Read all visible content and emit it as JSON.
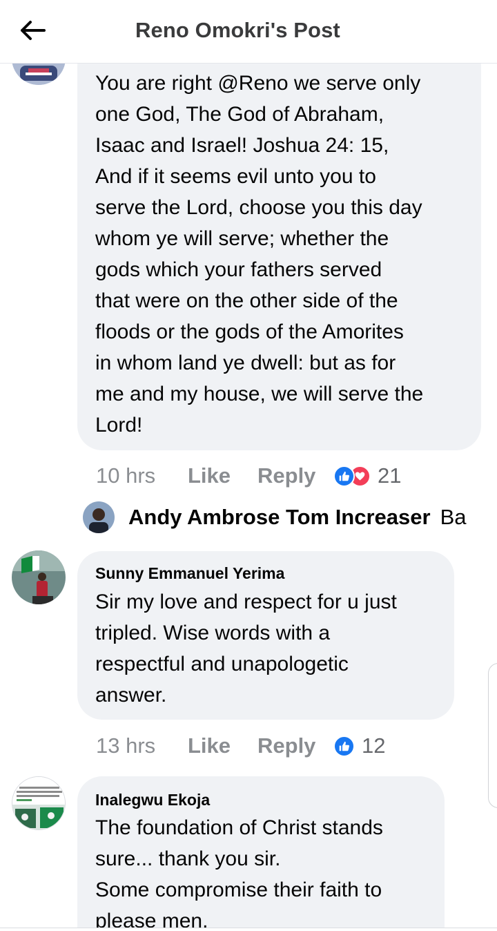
{
  "header": {
    "title": "Reno Omokri's Post"
  },
  "comments": [
    {
      "author": "",
      "text": "You are right @Reno we serve only\none God, The God of Abraham,\nIsaac and Israel! Joshua 24: 15,\nAnd if it seems evil unto you to\nserve the Lord, choose you this day\nwhom ye will serve; whether the\ngods which your fathers served\nthat were on the other side of the\nfloods or the gods of the Amorites\nin whom land ye dwell: but as for\nme and my house, we will serve the\nLord!",
      "time": "10 hrs",
      "like_label": "Like",
      "reply_label": "Reply",
      "reaction_count": "21",
      "reaction_icons": [
        "like-icon",
        "love-icon"
      ]
    },
    {
      "author": "Sunny Emmanuel Yerima",
      "text": "Sir my love and respect for u just\ntripled. Wise words with a\nrespectful and unapologetic\nanswer.",
      "time": "13 hrs",
      "like_label": "Like",
      "reply_label": "Reply",
      "reaction_count": "12",
      "reaction_icons": [
        "like-icon"
      ]
    },
    {
      "author": "Inalegwu Ekoja",
      "text": "The foundation of Christ stands\nsure... thank you sir.\nSome compromise their faith to\nplease men."
    }
  ],
  "reply_preview": {
    "author": "Andy Ambrose Tom Increaser",
    "text": "Ba"
  },
  "colors": {
    "like_blue": "#1877f2",
    "love_red": "#f33e58",
    "bubble": "#f0f2f5",
    "meta_gray": "#8a8d91"
  }
}
